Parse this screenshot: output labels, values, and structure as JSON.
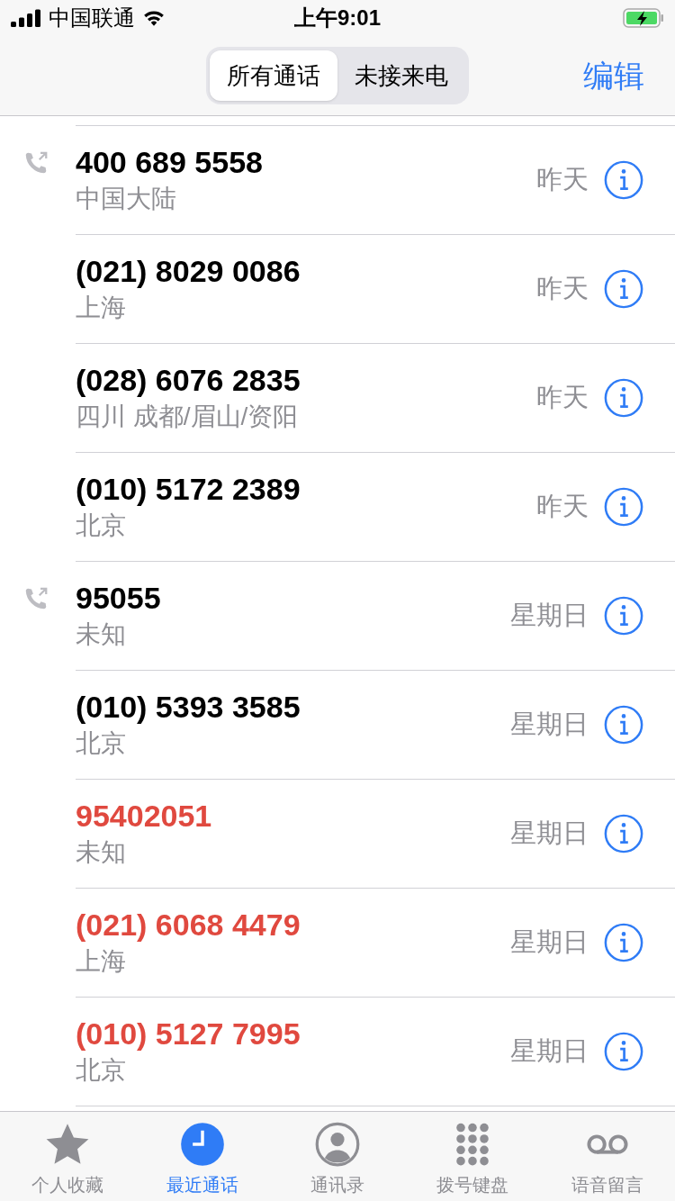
{
  "status_bar": {
    "carrier": "中国联通",
    "time": "上午9:01"
  },
  "segments": [
    {
      "label": "所有通话",
      "selected": true
    },
    {
      "label": "未接来电",
      "selected": false
    }
  ],
  "edit_button": "编辑",
  "calls": [
    {
      "number": "400 689 5558",
      "location": "中国大陆",
      "date": "昨天",
      "missed": false,
      "outgoing": true
    },
    {
      "number": "(021) 8029 0086",
      "location": "上海",
      "date": "昨天",
      "missed": false,
      "outgoing": false
    },
    {
      "number": "(028) 6076 2835",
      "location": "四川 成都/眉山/资阳",
      "date": "昨天",
      "missed": false,
      "outgoing": false
    },
    {
      "number": "(010) 5172 2389",
      "location": "北京",
      "date": "昨天",
      "missed": false,
      "outgoing": false
    },
    {
      "number": "95055",
      "location": "未知",
      "date": "星期日",
      "missed": false,
      "outgoing": true
    },
    {
      "number": "(010) 5393 3585",
      "location": "北京",
      "date": "星期日",
      "missed": false,
      "outgoing": false
    },
    {
      "number": "95402051",
      "location": "未知",
      "date": "星期日",
      "missed": true,
      "outgoing": false
    },
    {
      "number": "(021) 6068 4479",
      "location": "上海",
      "date": "星期日",
      "missed": true,
      "outgoing": false
    },
    {
      "number": "(010) 5127 7995",
      "location": "北京",
      "date": "星期日",
      "missed": true,
      "outgoing": false
    }
  ],
  "tab_bar": [
    {
      "label": "个人收藏",
      "kind": "star",
      "selected": false
    },
    {
      "label": "最近通话",
      "kind": "clock",
      "selected": true
    },
    {
      "label": "通讯录",
      "kind": "person",
      "selected": false
    },
    {
      "label": "拨号键盘",
      "kind": "keypad",
      "selected": false
    },
    {
      "label": "语音留言",
      "kind": "voicemail",
      "selected": false
    }
  ]
}
